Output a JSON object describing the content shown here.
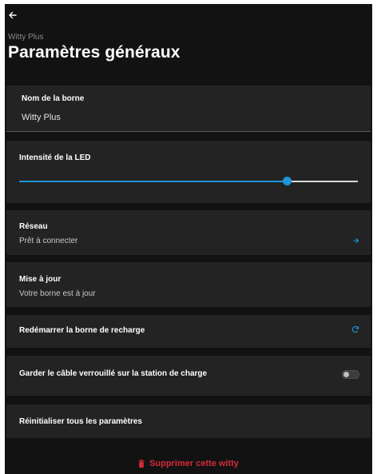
{
  "header": {
    "back_icon": "arrow-left-icon",
    "subtitle": "Witty Plus",
    "title": "Paramètres généraux"
  },
  "name_field": {
    "label": "Nom de la borne",
    "value": "Witty Plus"
  },
  "led": {
    "label": "Intensité de la LED",
    "level_fraction": 0.79
  },
  "network": {
    "label": "Réseau",
    "status": "Prêt à connecter",
    "icon": "arrow-right-icon"
  },
  "update": {
    "label": "Mise à jour",
    "status": "Votre borne est à jour"
  },
  "restart": {
    "label": "Redémarrer la borne de recharge",
    "icon": "refresh-icon"
  },
  "cable_lock": {
    "label": "Garder le câble verrouillé sur la station de charge",
    "enabled": false
  },
  "reset": {
    "label": "Réinitialiser tous les paramètres"
  },
  "delete": {
    "label": "Supprimer cette witty",
    "icon": "trash-icon"
  },
  "colors": {
    "background": "#121212",
    "card": "#232323",
    "accent": "#1e96d8",
    "danger": "#d62b3a"
  }
}
